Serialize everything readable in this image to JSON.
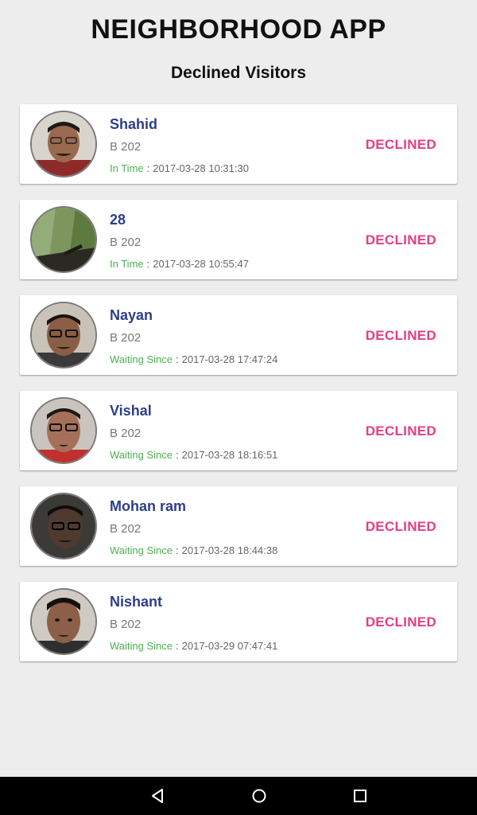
{
  "header": {
    "app_title": "NEIGHBORHOOD APP",
    "section_title": "Declined Visitors"
  },
  "visitors": [
    {
      "name": "Shahid",
      "flat": "B 202",
      "time_label": "In Time",
      "separator": ":",
      "time": "2017-03-28 10:31:30",
      "status": "DECLINED",
      "avatar": "avatar-photo-shahid"
    },
    {
      "name": "28",
      "flat": "B 202",
      "time_label": "In Time",
      "separator": ":",
      "time": "2017-03-28 10:55:47",
      "status": "DECLINED",
      "avatar": "avatar-photo-wall"
    },
    {
      "name": "Nayan",
      "flat": "B 202",
      "time_label": "Waiting Since",
      "separator": ":",
      "time": "2017-03-28 17:47:24",
      "status": "DECLINED",
      "avatar": "avatar-photo-nayan"
    },
    {
      "name": "Vishal",
      "flat": "B 202",
      "time_label": "Waiting Since",
      "separator": ":",
      "time": "2017-03-28 18:16:51",
      "status": "DECLINED",
      "avatar": "avatar-photo-vishal"
    },
    {
      "name": "Mohan ram",
      "flat": "B 202",
      "time_label": "Waiting Since",
      "separator": ":",
      "time": "2017-03-28 18:44:38",
      "status": "DECLINED",
      "avatar": "avatar-photo-mohan"
    },
    {
      "name": "Nishant",
      "flat": "B 202",
      "time_label": "Waiting Since",
      "separator": ":",
      "time": "2017-03-29 07:47:41",
      "status": "DECLINED",
      "avatar": "avatar-photo-nishant"
    }
  ],
  "navigation": {
    "back": "back-triangle-icon",
    "home": "home-circle-icon",
    "recents": "recents-square-icon"
  },
  "colors": {
    "name": "#2c3e8c",
    "time_label": "#4caf50",
    "status": "#e63e80",
    "background": "#ededed"
  }
}
